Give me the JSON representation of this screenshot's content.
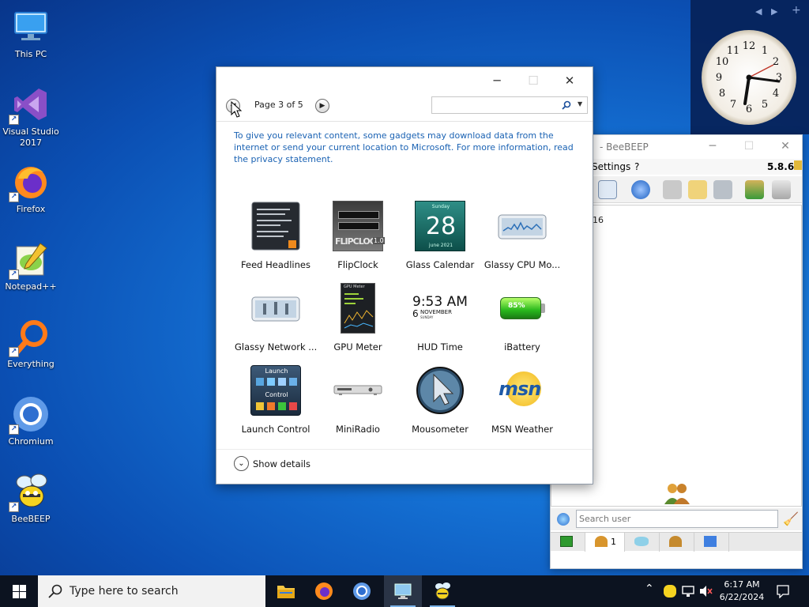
{
  "desktop": {
    "icons": [
      {
        "label": "This PC"
      },
      {
        "label": "Visual Studio 2017"
      },
      {
        "label": "Firefox"
      },
      {
        "label": "Notepad++"
      },
      {
        "label": "Everything"
      },
      {
        "label": "Chromium"
      },
      {
        "label": "BeeBEEP"
      }
    ]
  },
  "sidebar": {
    "prev": "◀",
    "next": "▶",
    "add": "+"
  },
  "beebeep": {
    "title": "- BeeBEEP",
    "menu_settings": "Settings",
    "menu_help": "?",
    "version": "5.8.6",
    "content_text": "16",
    "search_placeholder": "Search user",
    "users_tab_count": "1"
  },
  "gadget_window": {
    "page_indicator": "Page 3 of 5",
    "search_placeholder": "",
    "privacy_note": "To give you relevant content, some gadgets may download data from the internet or send your current location to Microsoft. For more information, read the privacy statement.",
    "gadgets": [
      {
        "name": "Feed Headlines"
      },
      {
        "name": "FlipClock"
      },
      {
        "name": "Glass Calendar"
      },
      {
        "name": "Glassy CPU Mo..."
      },
      {
        "name": "Glassy Network ..."
      },
      {
        "name": "GPU Meter"
      },
      {
        "name": "HUD Time"
      },
      {
        "name": "iBattery"
      },
      {
        "name": "Launch Control"
      },
      {
        "name": "MiniRadio"
      },
      {
        "name": "Mousometer"
      },
      {
        "name": "MSN Weather"
      }
    ],
    "thumb_text": {
      "calendar_day": "28",
      "calendar_month": "june 2021",
      "calendar_weekday": "Sunday",
      "flipclock": "FLIPCLOCK",
      "flipclock_ver": "1.0",
      "hud_time": "9:53 AM",
      "hud_day": "6",
      "hud_month": "NOVEMBER",
      "hud_weekday": "SUNDAY",
      "battery_pct": "85%",
      "launch_top": "Launch",
      "launch_bottom": "Control",
      "msn": "msn",
      "gpu_title": "GPU Meter"
    },
    "show_details": "Show details"
  },
  "taskbar": {
    "search_placeholder": "Type here to search",
    "time": "6:17 AM",
    "date": "6/22/2024"
  },
  "colors": {
    "accent": "#1a62b3",
    "taskbar": "#0c1320"
  }
}
